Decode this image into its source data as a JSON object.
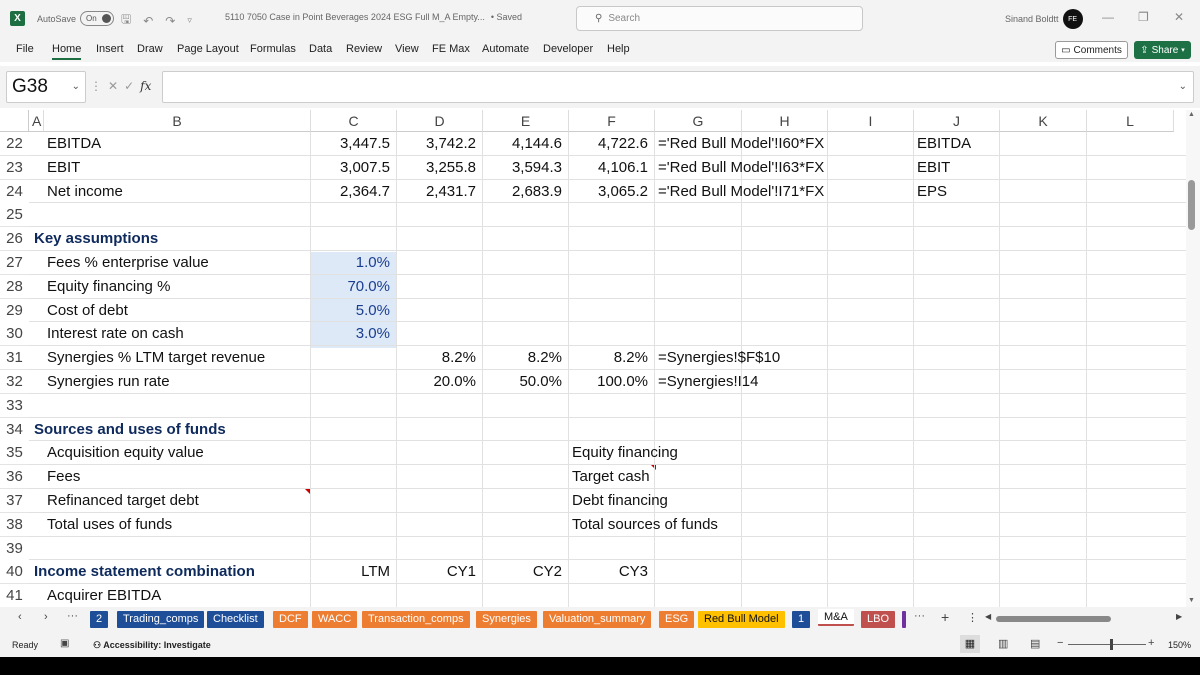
{
  "titlebar": {
    "autosave_label": "AutoSave",
    "autosave_state": "On",
    "filename": "5110 7050 Case in Point Beverages 2024 ESG Full M_A Empty...",
    "saved": "• Saved",
    "search_placeholder": "Search",
    "user": "Sinand Boldtt",
    "avatar": "FE"
  },
  "ribbon": {
    "tabs": [
      "File",
      "Home",
      "Insert",
      "Draw",
      "Page Layout",
      "Formulas",
      "Data",
      "Review",
      "View",
      "FE Max",
      "Automate",
      "Developer",
      "Help"
    ],
    "active": "Home",
    "comments": "Comments",
    "share": "Share"
  },
  "formula_bar": {
    "name_box": "G38",
    "fx": "fx",
    "value": ""
  },
  "columns": [
    "A",
    "B",
    "C",
    "D",
    "E",
    "F",
    "G",
    "H",
    "I",
    "J",
    "K",
    "L"
  ],
  "rows": [
    "22",
    "23",
    "24",
    "25",
    "26",
    "27",
    "28",
    "29",
    "30",
    "31",
    "32",
    "33",
    "34",
    "35",
    "36",
    "37",
    "38",
    "39",
    "40",
    "41"
  ],
  "cells": {
    "b22": "EBITDA",
    "c22": "3,447.5",
    "d22": "3,742.2",
    "e22": "4,144.6",
    "f22": "4,722.6",
    "g22": "='Red Bull Model'!I60*FX",
    "j22": "EBITDA",
    "b23": "EBIT",
    "c23": "3,007.5",
    "d23": "3,255.8",
    "e23": "3,594.3",
    "f23": "4,106.1",
    "g23": "='Red Bull Model'!I63*FX",
    "j23": "EBIT",
    "b24": "Net income",
    "c24": "2,364.7",
    "d24": "2,431.7",
    "e24": "2,683.9",
    "f24": "3,065.2",
    "g24": "='Red Bull Model'!I71*FX",
    "j24": "EPS",
    "a26": "Key assumptions",
    "b27": "Fees % enterprise value",
    "c27": "1.0%",
    "b28": "Equity financing %",
    "c28": "70.0%",
    "b29": "Cost of debt",
    "c29": "5.0%",
    "b30": "Interest rate on cash",
    "c30": "3.0%",
    "b31": "Synergies % LTM target revenue",
    "d31": "8.2%",
    "e31": "8.2%",
    "f31": "8.2%",
    "g31": "=Synergies!$F$10",
    "b32": "Synergies run rate",
    "d32": "20.0%",
    "e32": "50.0%",
    "f32": "100.0%",
    "g32": "=Synergies!I14",
    "a34": "Sources and uses of funds",
    "b35": "Acquisition equity value",
    "f35": "Equity financing",
    "b36": "Fees",
    "f36": "Target cash",
    "b37": "Refinanced target debt",
    "f37": "Debt financing",
    "b38": "Total uses of funds",
    "f38": "Total sources of funds",
    "a40": "Income statement combination",
    "c40": "LTM",
    "d40": "CY1",
    "e40": "CY2",
    "f40": "CY3",
    "b41": "Acquirer EBITDA"
  },
  "sheet_tabs": [
    {
      "label": "2",
      "color": "#1f4e99"
    },
    {
      "label": "Trading_comps",
      "color": "#1f4e99"
    },
    {
      "label": "Checklist",
      "color": "#1f4e99"
    },
    {
      "label": "DCF",
      "color": "#ed7d31"
    },
    {
      "label": "WACC",
      "color": "#ed7d31"
    },
    {
      "label": "Transaction_comps",
      "color": "#ed7d31"
    },
    {
      "label": "Synergies",
      "color": "#ed7d31"
    },
    {
      "label": "Valuation_summary",
      "color": "#ed7d31"
    },
    {
      "label": "ESG",
      "color": "#ed7d31"
    },
    {
      "label": "Red Bull Model",
      "color": "#ffc000"
    },
    {
      "label": "1",
      "color": "#1f4e99"
    },
    {
      "label": "M&A",
      "color": "#ffffff"
    },
    {
      "label": "LBO",
      "color": "#c0504d"
    }
  ],
  "status": {
    "ready": "Ready",
    "accessibility": "Accessibility: Investigate",
    "zoom": "150%"
  }
}
